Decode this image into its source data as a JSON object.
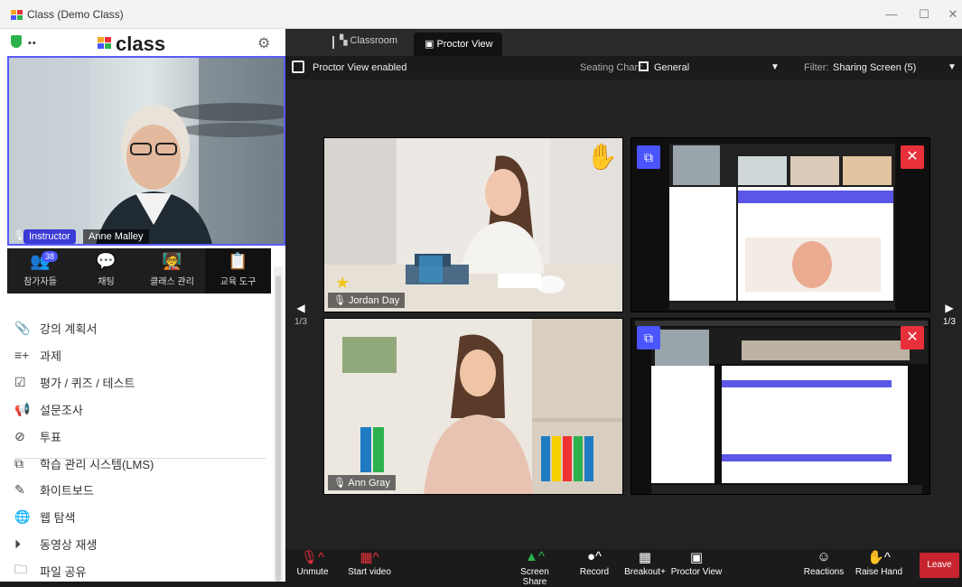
{
  "window": {
    "title": "Class (Demo Class)",
    "minimize": "—",
    "maximize": "☐",
    "close": "✕"
  },
  "sidebar_top": {
    "logo_text": "class",
    "dots": "••"
  },
  "instructor": {
    "badge": "Instructor",
    "name": "Anne Malley"
  },
  "icon_tabs": [
    {
      "label": "참가자들",
      "badge": "38"
    },
    {
      "label": "채팅"
    },
    {
      "label": "클래스 관리"
    },
    {
      "label": "교육 도구"
    }
  ],
  "menu": [
    {
      "label": "강의 계획서",
      "icon": "paperclip-icon"
    },
    {
      "label": "과제",
      "icon": "list-add-icon"
    },
    {
      "label": "평가 / 퀴즈 / 테스트",
      "icon": "checklist-icon"
    },
    {
      "label": "설문조사",
      "icon": "megaphone-icon"
    },
    {
      "label": "투표",
      "icon": "check-circle-icon"
    },
    {
      "label": "학습 관리 시스템(LMS)",
      "icon": "external-link-icon"
    }
  ],
  "menu2": [
    {
      "label": "화이트보드",
      "icon": "pen-icon"
    },
    {
      "label": "웹 탐색",
      "icon": "globe-icon"
    },
    {
      "label": "동영상 재생",
      "icon": "play-circle-icon"
    },
    {
      "label": "파일 공유",
      "icon": "folder-icon"
    }
  ],
  "tabs": {
    "classroom": "Classroom",
    "proctor": "Proctor View"
  },
  "infobar": {
    "status": "Proctor View enabled",
    "seating_label": "Seating Chart:",
    "seating_value": "General",
    "filter_label": "Filter:",
    "filter_value": "Sharing Screen (5)"
  },
  "pager": {
    "left": "1/3",
    "right": "1/3"
  },
  "participants": [
    {
      "name": "Jordan Day"
    },
    {
      "name": "Ann Gray"
    }
  ],
  "toolbar": {
    "unmute": "Unmute",
    "start_video": "Start video",
    "screen_share": "Screen Share",
    "record": "Record",
    "breakout": "Breakout+",
    "proctor_view": "Proctor View",
    "reactions": "Reactions",
    "raise_hand": "Raise Hand",
    "leave": "Leave"
  },
  "colors": {
    "accent": "#4a55ff",
    "danger": "#e8303a",
    "leave": "#c8242f",
    "secure": "#2bb24c"
  }
}
